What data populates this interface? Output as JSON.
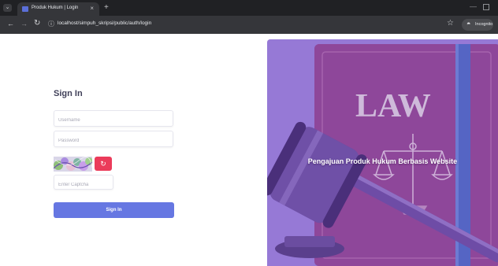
{
  "browser": {
    "tab_title": "Produk Hukum | Login",
    "tab_close": "×",
    "new_tab": "+",
    "url": "localhost/simpuh_skripsi/public/auth/login",
    "incognito_label": "Incognito"
  },
  "login": {
    "heading": "Sign In",
    "username_placeholder": "Username",
    "password_placeholder": "Password",
    "captcha_placeholder": "Enter Captcha",
    "refresh_glyph": "↻",
    "submit_label": "Sign In"
  },
  "hero": {
    "tagline": "Pengajuan Produk Hukum Berbasis Website",
    "book_title": "LAW"
  },
  "colors": {
    "accent": "#6677e2",
    "refresh": "#eb3b5a",
    "hero_bg": "#8d6fd2"
  }
}
